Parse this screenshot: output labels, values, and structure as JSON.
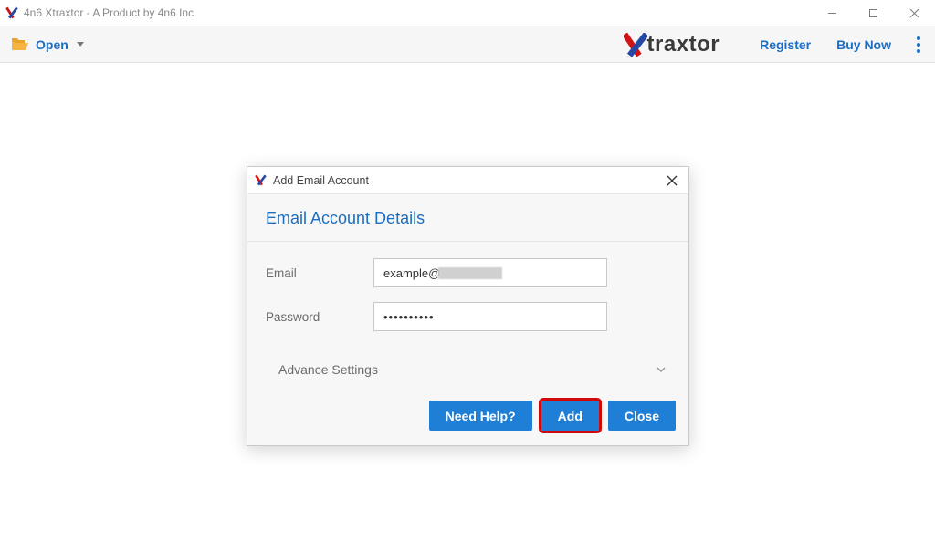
{
  "window": {
    "title": "4n6 Xtraxtor - A Product by 4n6 Inc"
  },
  "toolbar": {
    "open_label": "Open",
    "brand_bold": "X",
    "brand_light": "traxtor",
    "register_label": "Register",
    "buy_now_label": "Buy Now"
  },
  "dialog": {
    "title": "Add Email Account",
    "section_title": "Email Account Details",
    "email_label": "Email",
    "email_value": "example@",
    "password_label": "Password",
    "password_value": "••••••••••",
    "advance_label": "Advance Settings",
    "buttons": {
      "help": "Need Help?",
      "add": "Add",
      "close": "Close"
    }
  }
}
